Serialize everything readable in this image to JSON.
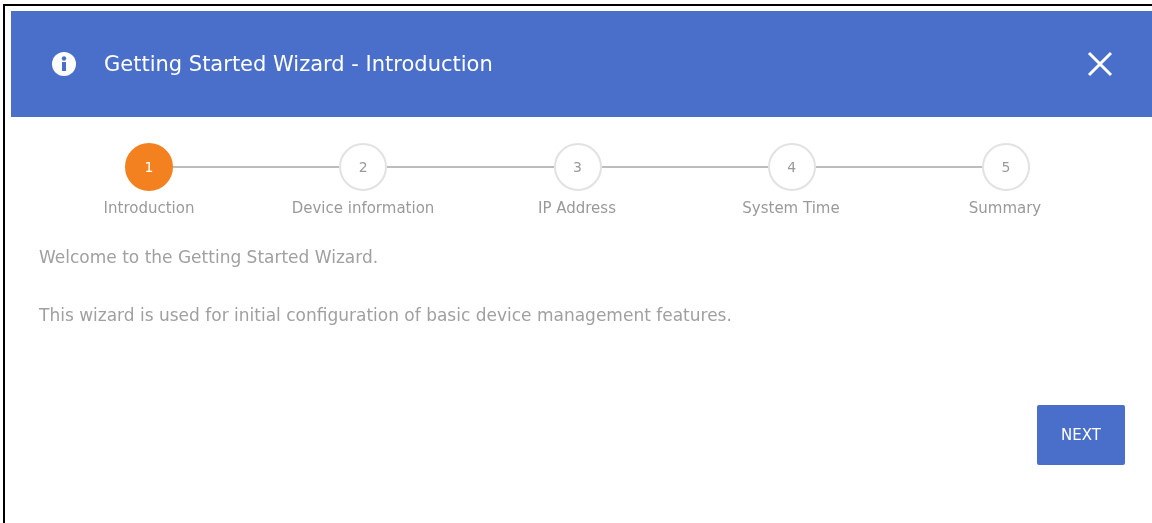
{
  "dialog": {
    "title": "Getting Started Wizard - Introduction"
  },
  "steps": [
    {
      "number": "1",
      "label": "Introduction",
      "selected": true
    },
    {
      "number": "2",
      "label": "Device information",
      "selected": false
    },
    {
      "number": "3",
      "label": "IP Address",
      "selected": false
    },
    {
      "number": "4",
      "label": "System Time",
      "selected": false
    },
    {
      "number": "5",
      "label": "Summary",
      "selected": false
    }
  ],
  "paragraphs": [
    "Welcome to the Getting Started Wizard.",
    "This wizard is used for initial configuration of basic device management features."
  ],
  "buttons": [
    "NEXT"
  ]
}
